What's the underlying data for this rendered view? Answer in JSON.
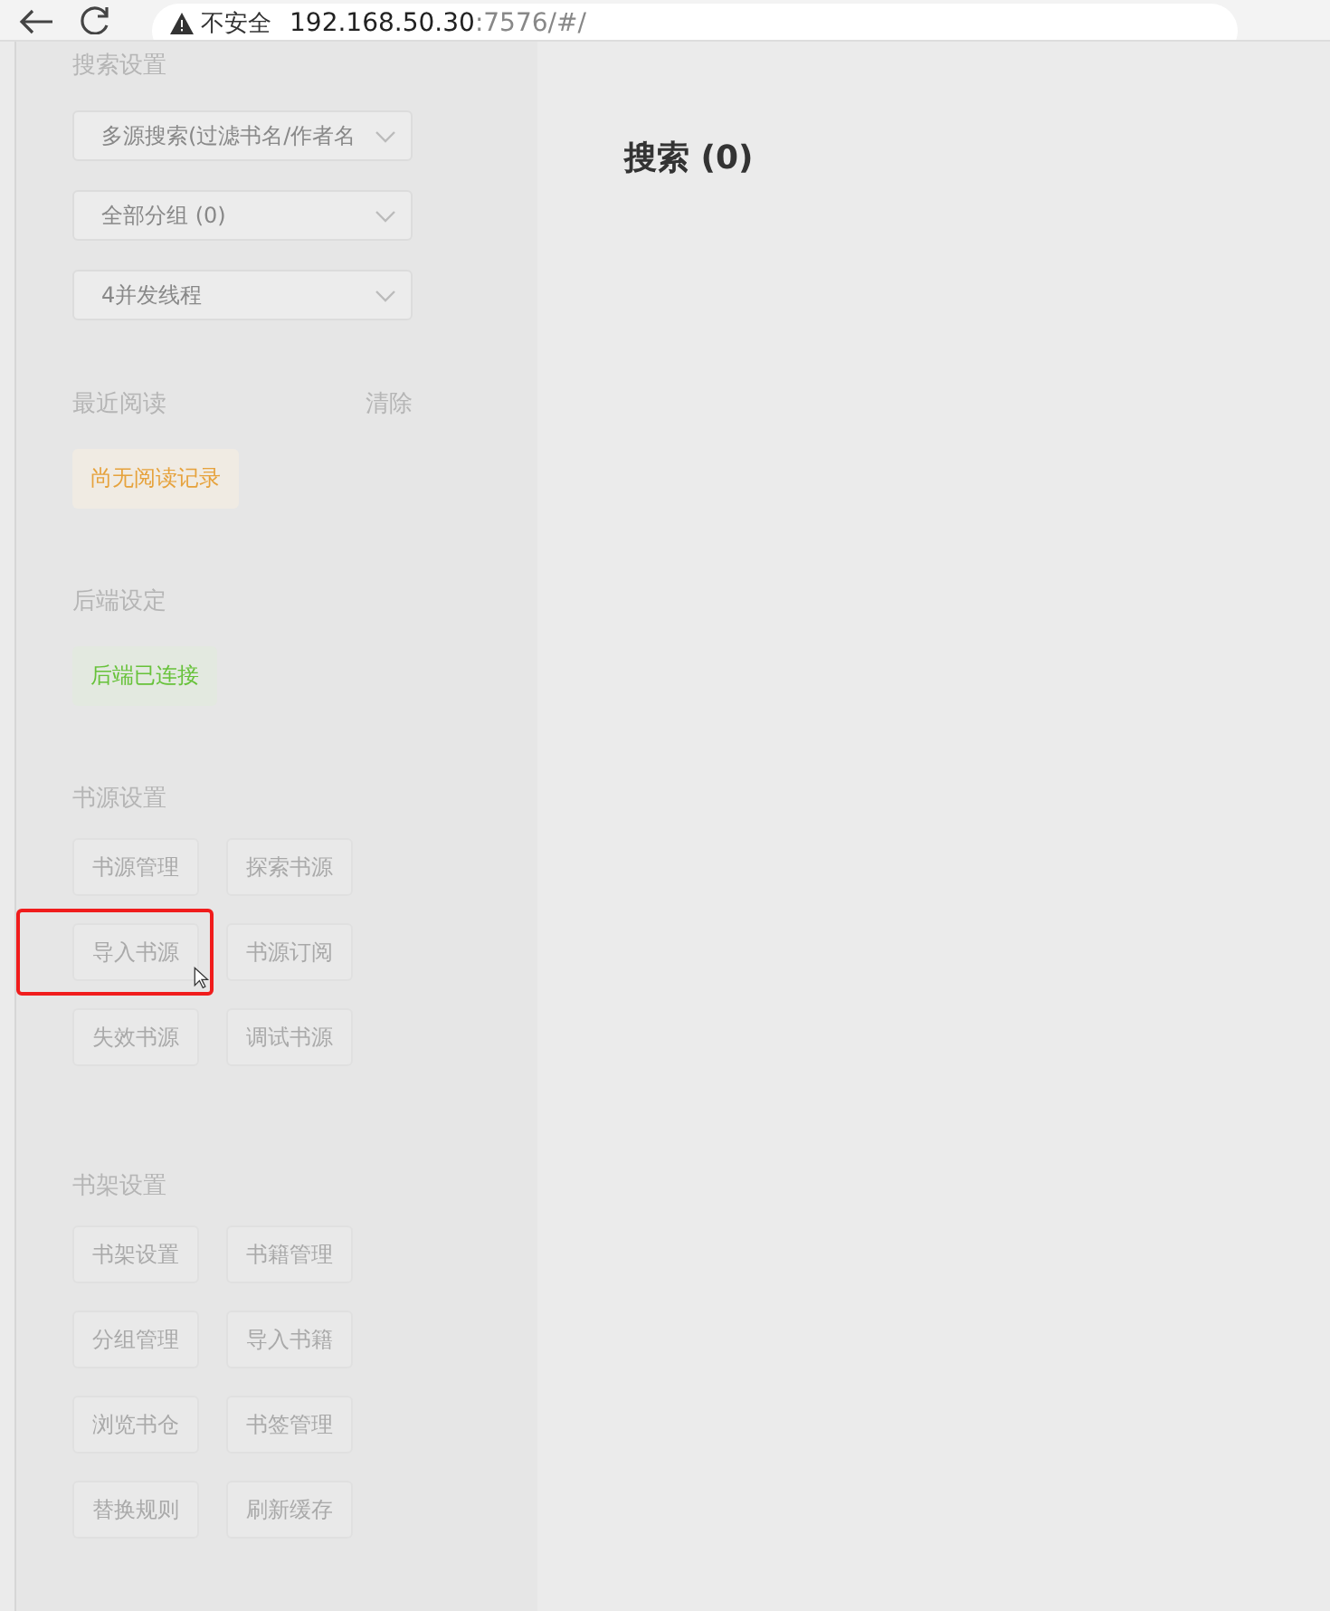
{
  "browser": {
    "security_label": "不安全",
    "host": "192.168.50.30",
    "path": ":7576/#/"
  },
  "sidebar": {
    "search_settings": {
      "title": "搜索设置",
      "selects": [
        {
          "value": "多源搜索(过滤书名/作者名"
        },
        {
          "value": "全部分组 (0)"
        },
        {
          "value": "4并发线程"
        }
      ]
    },
    "recent_reading": {
      "title": "最近阅读",
      "action": "清除",
      "tag": {
        "text": "尚无阅读记录",
        "kind": "warning"
      }
    },
    "backend": {
      "title": "后端设定",
      "tag": {
        "text": "后端已连接",
        "kind": "success"
      }
    },
    "button_groups": [
      {
        "title": "书源设置",
        "buttons": [
          {
            "label": "书源管理",
            "highlighted": false
          },
          {
            "label": "探索书源",
            "highlighted": false
          },
          {
            "label": "导入书源",
            "highlighted": true
          },
          {
            "label": "书源订阅",
            "highlighted": false
          },
          {
            "label": "失效书源",
            "highlighted": false
          },
          {
            "label": "调试书源",
            "highlighted": false
          }
        ]
      },
      {
        "title": "书架设置",
        "buttons": [
          {
            "label": "书架设置",
            "highlighted": false
          },
          {
            "label": "书籍管理",
            "highlighted": false
          },
          {
            "label": "分组管理",
            "highlighted": false
          },
          {
            "label": "导入书籍",
            "highlighted": false
          },
          {
            "label": "浏览书仓",
            "highlighted": false
          },
          {
            "label": "书签管理",
            "highlighted": false
          },
          {
            "label": "替换规则",
            "highlighted": false
          },
          {
            "label": "刷新缓存",
            "highlighted": false
          }
        ]
      }
    ]
  },
  "main": {
    "title": "搜索 (0)"
  }
}
